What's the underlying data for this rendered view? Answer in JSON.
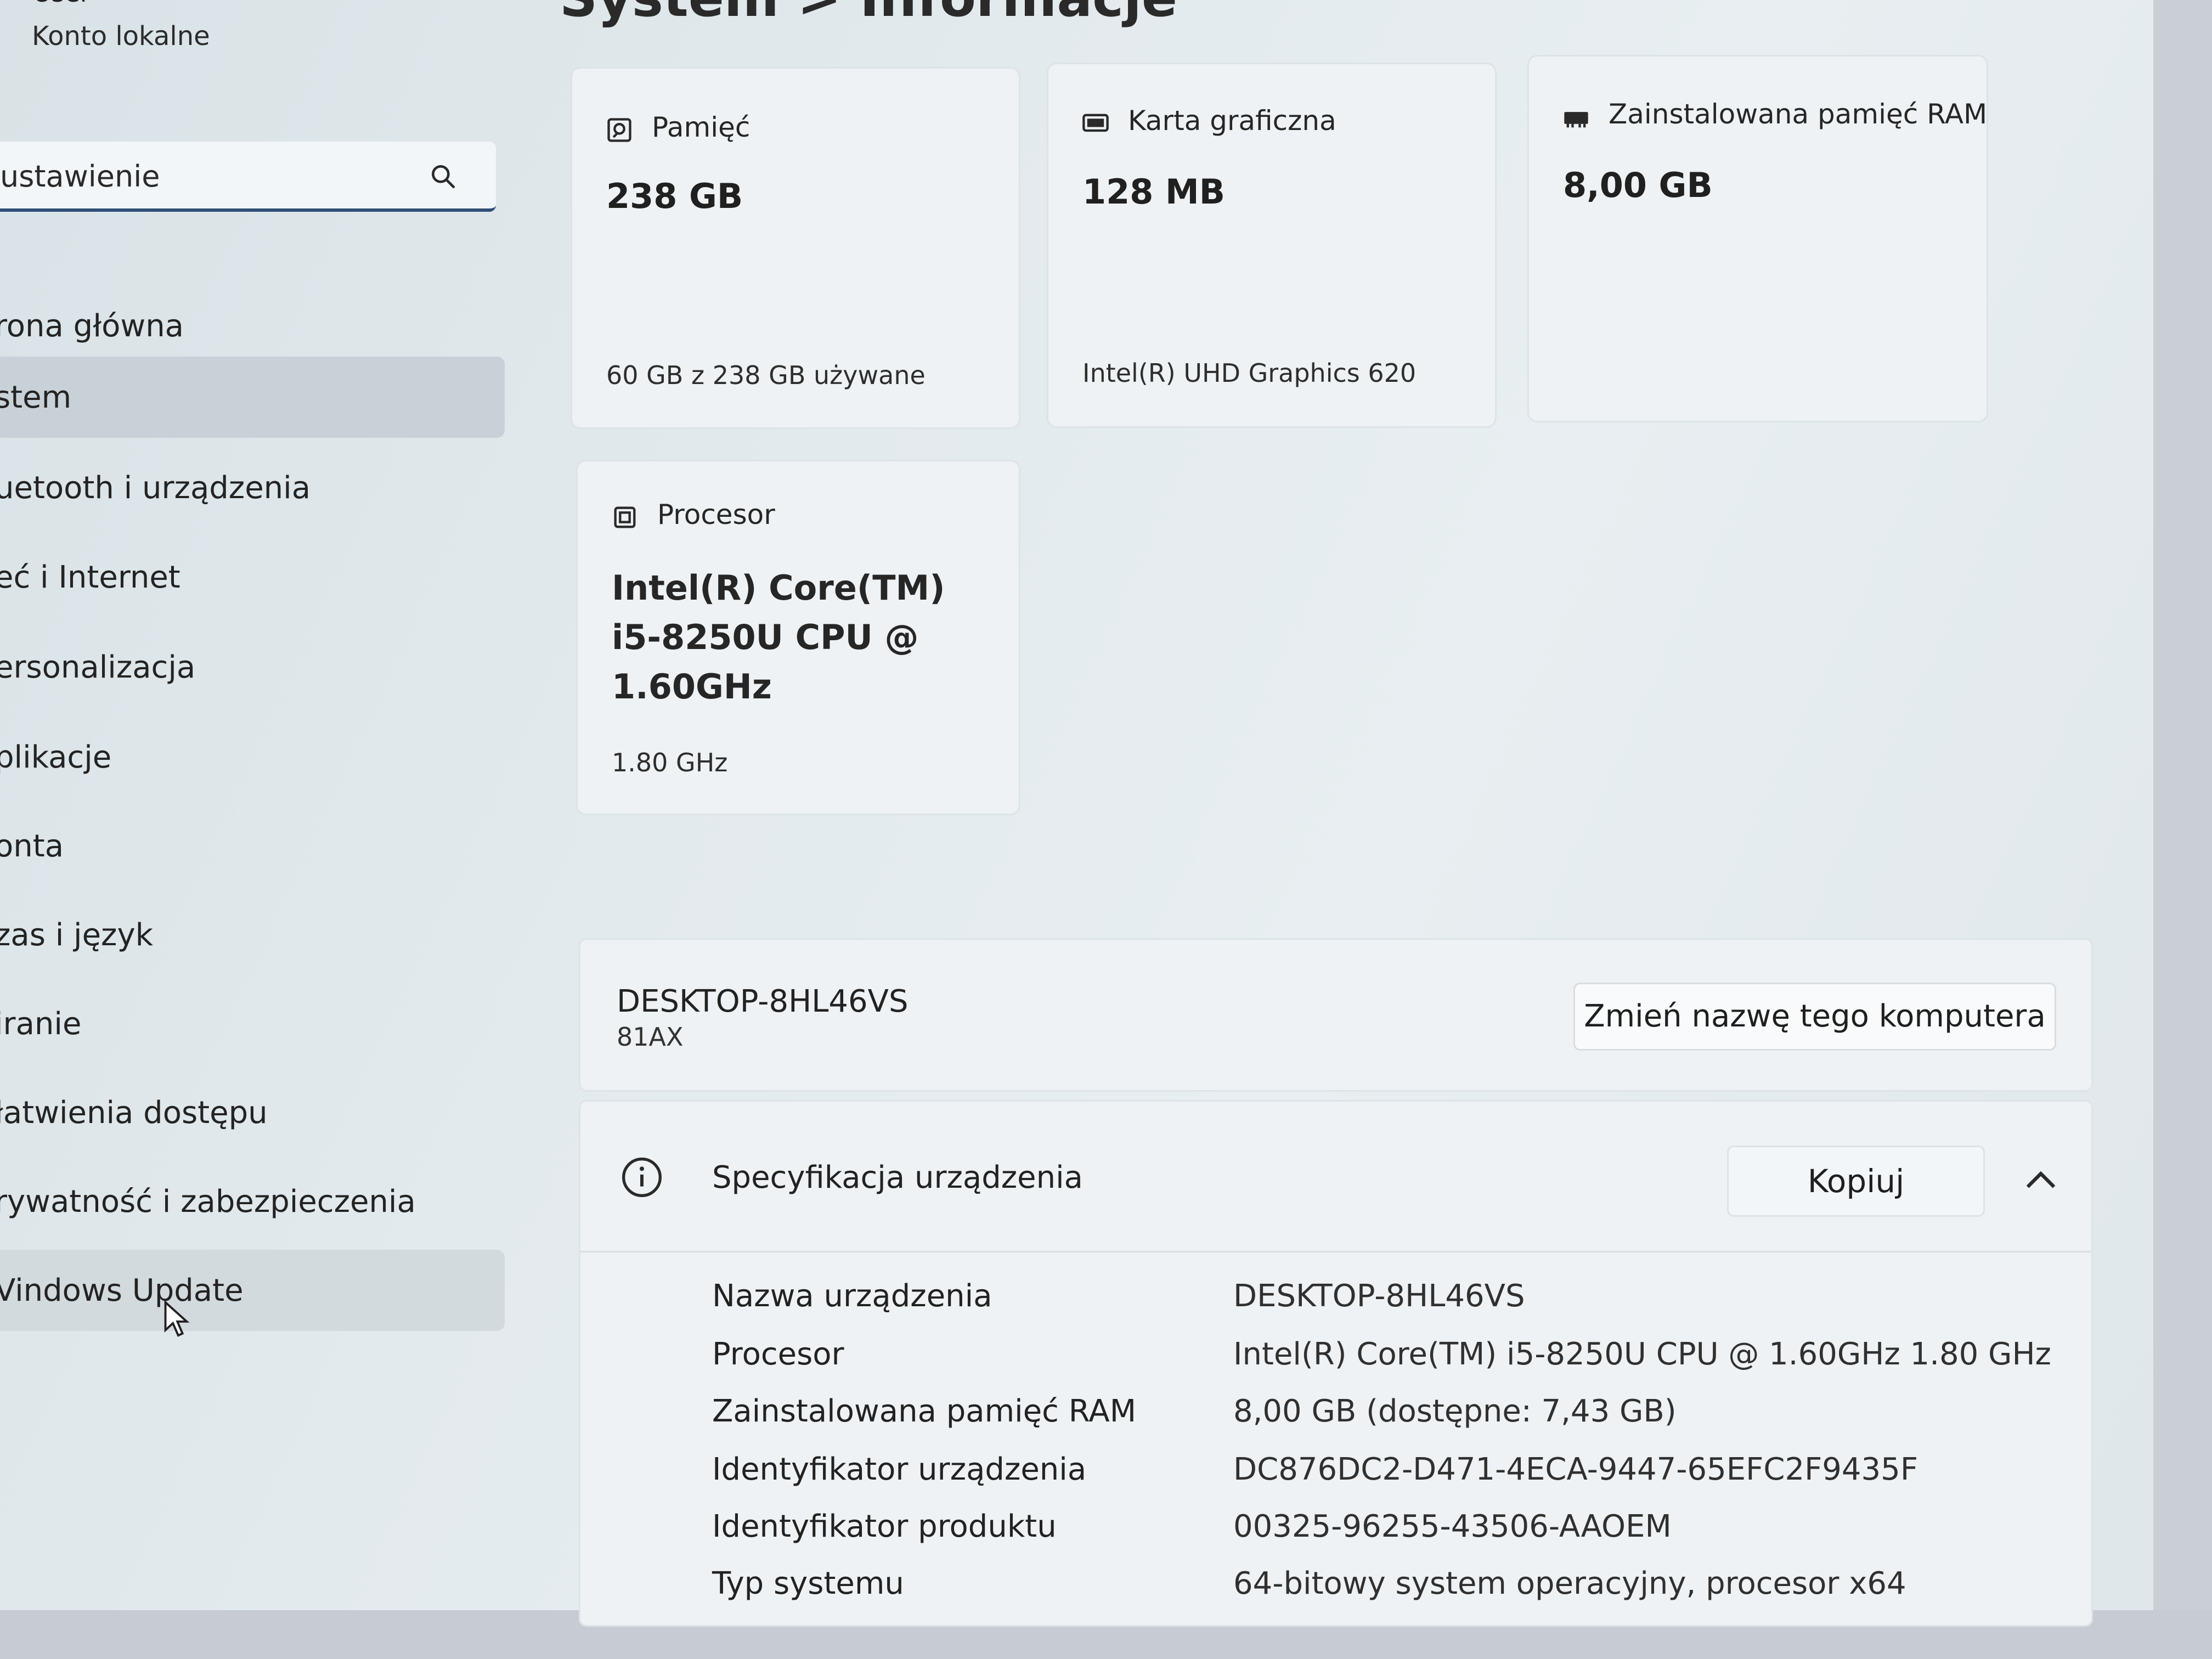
{
  "user": {
    "name": "User",
    "account_type": "Konto lokalne"
  },
  "page_title": "System > Informacje",
  "search": {
    "value": "ustawienie",
    "icon": "search-icon"
  },
  "sidebar": {
    "items": [
      {
        "label": "rona główna"
      },
      {
        "label": "stem"
      },
      {
        "label": "uetooth i urządzenia"
      },
      {
        "label": "eć i Internet"
      },
      {
        "label": "ersonalizacja"
      },
      {
        "label": "plikacje"
      },
      {
        "label": "onta"
      },
      {
        "label": "zas i język"
      },
      {
        "label": "iranie"
      },
      {
        "label": "łatwienia dostępu"
      },
      {
        "label": "rywatność i zabezpieczenia"
      },
      {
        "label": "Vindows Update"
      }
    ]
  },
  "cards": {
    "storage": {
      "title": "Pamięć",
      "value": "238 GB",
      "sub": "60 GB z 238 GB używane",
      "icon": "storage-icon"
    },
    "gpu": {
      "title": "Karta graficzna",
      "value": "128 MB",
      "sub": "Intel(R) UHD Graphics 620",
      "icon": "display-icon"
    },
    "ram": {
      "title": "Zainstalowana pamięć RAM",
      "value": "8,00 GB",
      "icon": "ram-icon"
    },
    "cpu": {
      "title": "Procesor",
      "value_lines": [
        "Intel(R) Core(TM)",
        "i5-8250U CPU @",
        "1.60GHz"
      ],
      "sub": "1.80 GHz",
      "icon": "processor-icon"
    }
  },
  "device": {
    "name": "DESKTOP-8HL46VS",
    "model": "81AX",
    "rename_button": "Zmień nazwę tego komputera"
  },
  "spec": {
    "title": "Specyfikacja urządzenia",
    "copy_button": "Kopiuj",
    "rows": [
      {
        "label": "Nazwa urządzenia",
        "value": "DESKTOP-8HL46VS"
      },
      {
        "label": "Procesor",
        "value": "Intel(R) Core(TM) i5-8250U CPU @ 1.60GHz   1.80 GHz"
      },
      {
        "label": "Zainstalowana pamięć RAM",
        "value": "8,00 GB (dostępne: 7,43 GB)"
      },
      {
        "label": "Identyfikator urządzenia",
        "value": "DC876DC2-D471-4ECA-9447-65EFC2F9435F"
      },
      {
        "label": "Identyfikator produktu",
        "value": "00325-96255-43506-AAOEM"
      },
      {
        "label": "Typ systemu",
        "value": "64-bitowy system operacyjny, procesor x64"
      }
    ]
  }
}
